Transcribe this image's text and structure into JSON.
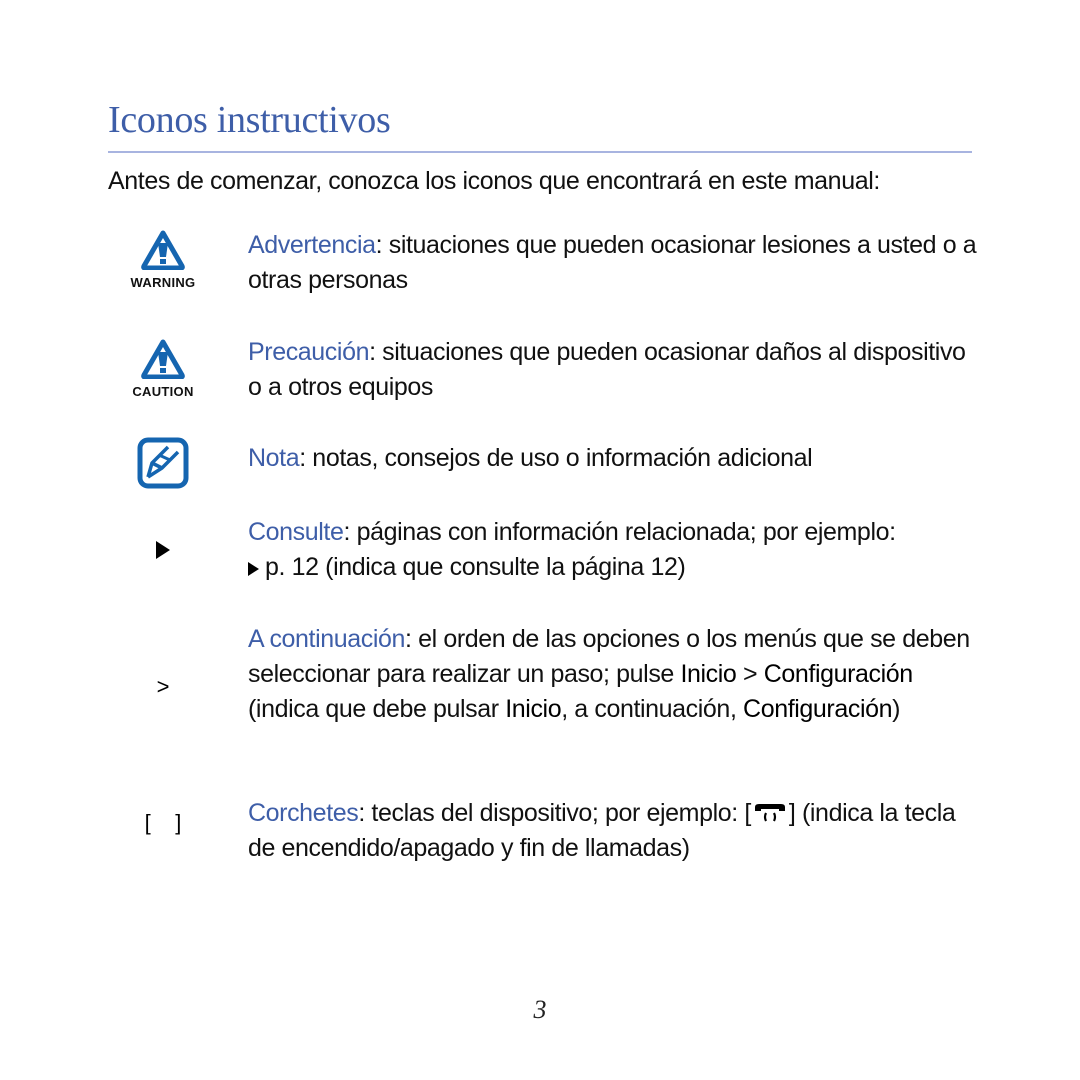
{
  "page": {
    "title": "Iconos instructivos",
    "intro": "Antes de comenzar, conozca los iconos que encontrará en este manual:",
    "page_number": "3",
    "accent_color": "#3e5ea8",
    "icon_color": "#1565b0"
  },
  "entries": {
    "warning": {
      "icon": "warning-triangle-icon",
      "icon_label": "WARNING",
      "term": "Advertencia",
      "text": ": situaciones que pueden ocasionar lesiones a usted o a otras personas"
    },
    "caution": {
      "icon": "caution-triangle-icon",
      "icon_label": "CAUTION",
      "term": "Precaución",
      "text": ": situaciones que pueden ocasionar daños al dispositivo o a otros equipos"
    },
    "note": {
      "icon": "note-pencil-icon",
      "term": "Nota",
      "text": ": notas, consejos de uso o información adicional"
    },
    "refer": {
      "icon": "play-triangle-icon",
      "term": "Consulte",
      "text": ": páginas con información relacionada; por ejemplo:",
      "example": "p. 12 (indica que consulte la página 12)"
    },
    "next": {
      "icon_glyph": ">",
      "term": "A continuación",
      "text1": ": el orden de las opciones o los menús que se deben seleccionar para realizar un paso; pulse ",
      "b1": "Inicio",
      "t2": " > ",
      "b2": "Configuración",
      "t3": " (indica que debe pulsar ",
      "b3": "Inicio",
      "t4": ", a continuación, ",
      "b4": "Configuración",
      "t5": ")"
    },
    "brackets": {
      "icon_glyph": "[    ]",
      "term": "Corchetes",
      "text1": ": teclas del dispositivo; por ejemplo: [",
      "key_icon": "end-call-power-key-icon",
      "text2": "] (indica la tecla de encendido/apagado y fin de llamadas)"
    }
  }
}
